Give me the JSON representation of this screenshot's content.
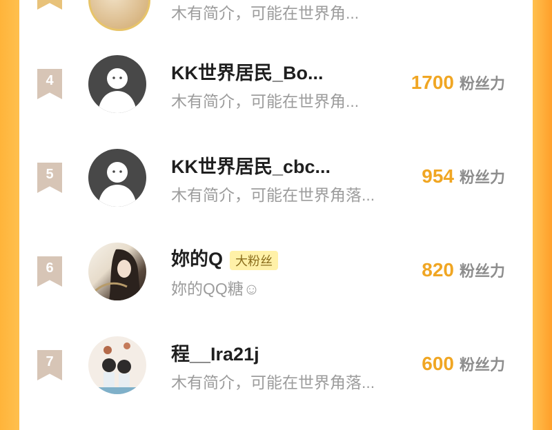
{
  "top_partial": {
    "bio": "木有简介，可能在世界角..."
  },
  "rows": [
    {
      "rank": "4",
      "name": "KK世界居民_Bo...",
      "bio": "木有简介，可能在世界角...",
      "score": "1700",
      "unit": "粉丝力"
    },
    {
      "rank": "5",
      "name": "KK世界居民_cbc...",
      "bio": "木有简介，可能在世界角落...",
      "score": "954",
      "unit": "粉丝力"
    },
    {
      "rank": "6",
      "name": "妳的Q",
      "badge": "大粉丝",
      "bio": "妳的QQ糖☺",
      "score": "820",
      "unit": "粉丝力"
    },
    {
      "rank": "7",
      "name": "程__Ira21j",
      "bio": "木有简介，可能在世界角落...",
      "score": "600",
      "unit": "粉丝力"
    }
  ],
  "colors": {
    "accent": "#f0a623",
    "rank_badge": "#d7c5b6",
    "border": "#ffb43a"
  }
}
